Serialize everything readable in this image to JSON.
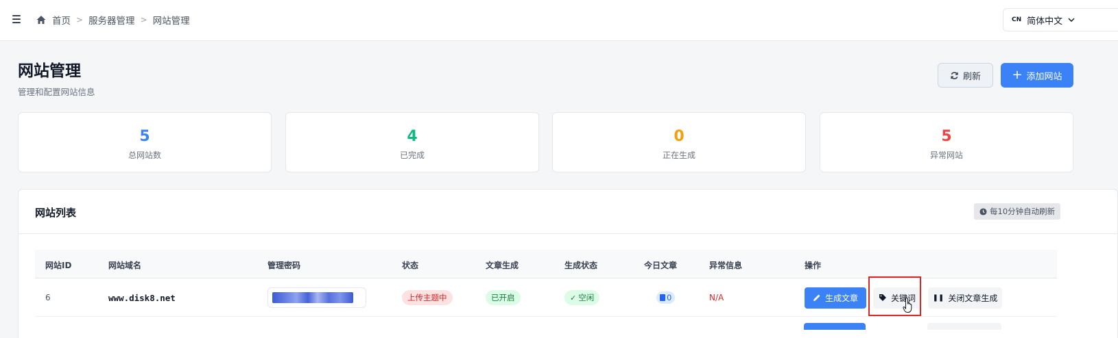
{
  "breadcrumb": {
    "items": [
      "首页",
      "服务器管理",
      "网站管理"
    ]
  },
  "language": {
    "flag": "CN",
    "selected": "简体中文"
  },
  "header": {
    "title": "网站管理",
    "subtitle": "管理和配置网站信息",
    "refresh_label": "刷新",
    "add_label": "添加网站"
  },
  "stats": [
    {
      "value": "5",
      "label": "总网站数",
      "color": "#3b82f6"
    },
    {
      "value": "4",
      "label": "已完成",
      "color": "#10b981"
    },
    {
      "value": "0",
      "label": "正在生成",
      "color": "#f59e0b"
    },
    {
      "value": "5",
      "label": "异常网站",
      "color": "#ef4444"
    }
  ],
  "panel": {
    "title": "网站列表",
    "auto_refresh": "每10分钟自动刷新"
  },
  "table": {
    "columns": [
      "网站ID",
      "网站域名",
      "管理密码",
      "状态",
      "文章生成",
      "生成状态",
      "今日文章",
      "异常信息",
      "操作"
    ],
    "rows": [
      {
        "id": "6",
        "domain": "www.disk8.net",
        "status": "上传主题中",
        "article_gen": "已开启",
        "gen_status": "空闲",
        "today_articles": "0",
        "error": "N/A",
        "actions": {
          "generate": "生成文章",
          "keywords": "关键词",
          "stop": "关闭文章生成"
        }
      }
    ]
  },
  "colors": {
    "primary": "#3b82f6",
    "danger": "#dc2626",
    "success": "#15803d"
  }
}
